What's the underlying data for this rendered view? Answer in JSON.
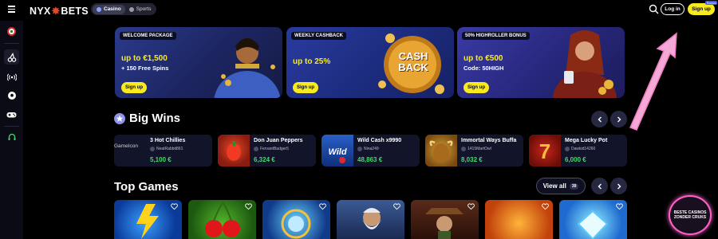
{
  "header": {
    "logo_left": "NYX",
    "logo_right": "BETS",
    "tabs": [
      {
        "label": "Casino",
        "active": true
      },
      {
        "label": "Sports",
        "active": false
      }
    ],
    "login_label": "Log in",
    "signup_label": "Sign up",
    "signup_tag": "Bonus"
  },
  "banners": [
    {
      "label": "WELCOME PACKAGE",
      "title": "up to €1,500",
      "sub": "+ 150 Free Spins",
      "button": "Sign up"
    },
    {
      "label": "WEEKLY CASHBACK",
      "title": "up to 25%",
      "sub": "",
      "button": "Sign up",
      "art": "CASH BACK"
    },
    {
      "label": "50% HIGHROLLER BONUS",
      "title": "up to €500",
      "sub": "Code: 50HIGH",
      "button": "Sign up"
    }
  ],
  "big_wins": {
    "title": "Big Wins",
    "items": [
      {
        "game": "3 Hot Chillies",
        "user": "NeatRabbit861",
        "amount": "5,100 €",
        "alt": "GameIcon"
      },
      {
        "game": "Don Juan Peppers",
        "user": "FervantBadger5",
        "amount": "6,324 €"
      },
      {
        "game": "Wild Cash x9990",
        "user": "Nina249",
        "amount": "48,863 €"
      },
      {
        "game": "Immortal Ways Buffa",
        "user": "1415MartOwl",
        "amount": "8,032 €"
      },
      {
        "game": "Mega Lucky Pot",
        "user": "Dawkid14260",
        "amount": "6,000 €"
      }
    ]
  },
  "top_games": {
    "title": "Top Games",
    "view_all": "View all",
    "count": "39"
  },
  "badge": {
    "text": "BESTE CASINOS ZONDER CRUKS"
  },
  "colors": {
    "accent_yellow": "#f8ea1d",
    "win_green": "#3fdc6c",
    "brand_red": "#e8452b",
    "pink": "#ff61c7"
  }
}
